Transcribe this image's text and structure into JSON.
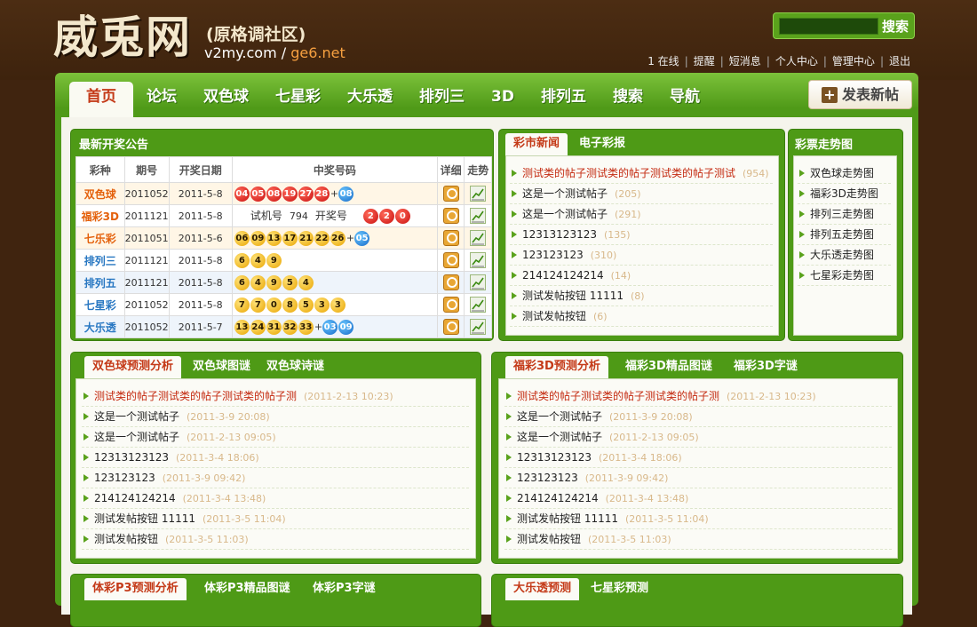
{
  "header": {
    "logo_text": "威兎网",
    "logo_sub": "(原格调社区)",
    "logo_domain1": "v2my.com /",
    "logo_domain2": "ge6.net",
    "search_button": "搜索",
    "search_value": "",
    "user_links": [
      {
        "label": "1 在线",
        "bold": "1"
      },
      {
        "label": "提醒"
      },
      {
        "label": "短消息"
      },
      {
        "label": "个人中心"
      },
      {
        "label": "管理中心"
      },
      {
        "label": "退出"
      }
    ]
  },
  "nav": {
    "tabs": [
      "首页",
      "论坛",
      "双色球",
      "七星彩",
      "大乐透",
      "排列三",
      "3D",
      "排列五",
      "搜索",
      "导航"
    ],
    "active": "首页",
    "post_button": "发表新帖"
  },
  "lottery_box": {
    "title": "最新开奖公告",
    "headers": [
      "彩种",
      "期号",
      "开奖日期",
      "中奖号码",
      "详细",
      "走势"
    ],
    "rows": [
      {
        "kind": "双色球",
        "color": "orange",
        "issue": "2011052",
        "date": "2011-5-8",
        "reds": [
          "04",
          "05",
          "08",
          "19",
          "27",
          "28"
        ],
        "blues": [
          "08"
        ],
        "red_type": "red"
      },
      {
        "kind": "福彩3D",
        "color": "orange",
        "issue": "2011121",
        "date": "2011-5-8",
        "special": true,
        "trial_label": "试机号",
        "trial": "794",
        "draw_label": "开奖号",
        "reds": [
          "2",
          "2",
          "0"
        ],
        "red_type": "red"
      },
      {
        "kind": "七乐彩",
        "color": "orange",
        "issue": "2011051",
        "date": "2011-5-6",
        "reds": [
          "06",
          "09",
          "13",
          "17",
          "21",
          "22",
          "26"
        ],
        "blues": [
          "05"
        ],
        "red_type": "yel"
      },
      {
        "kind": "排列三",
        "color": "blue",
        "issue": "2011121",
        "date": "2011-5-8",
        "reds": [
          "6",
          "4",
          "9"
        ],
        "red_type": "yel"
      },
      {
        "kind": "排列五",
        "color": "blue",
        "issue": "2011121",
        "date": "2011-5-8",
        "reds": [
          "6",
          "4",
          "9",
          "5",
          "4"
        ],
        "red_type": "yel"
      },
      {
        "kind": "七星彩",
        "color": "blue",
        "issue": "2011052",
        "date": "2011-5-8",
        "reds": [
          "7",
          "7",
          "0",
          "8",
          "5",
          "3",
          "3"
        ],
        "red_type": "yel"
      },
      {
        "kind": "大乐透",
        "color": "blue",
        "issue": "2011052",
        "date": "2011-5-7",
        "reds": [
          "13",
          "24",
          "31",
          "32",
          "33"
        ],
        "blues": [
          "03",
          "09"
        ],
        "red_type": "yel"
      }
    ]
  },
  "news_box": {
    "tabs": [
      "彩市新闻",
      "电子彩报"
    ],
    "items": [
      {
        "title": "测试类的帖子测试类的帖子测试类的帖子测试",
        "count": "(954)",
        "hot": true
      },
      {
        "title": "这是一个测试帖子",
        "count": "(205)"
      },
      {
        "title": "这是一个测试帖子",
        "count": "(291)"
      },
      {
        "title": "12313123123",
        "count": "(135)"
      },
      {
        "title": "123123123",
        "count": "(310)"
      },
      {
        "title": "214124124214",
        "count": "(14)"
      },
      {
        "title": "测试发帖按钮 11111",
        "count": "(8)"
      },
      {
        "title": "测试发帖按钮",
        "count": "(6)"
      }
    ]
  },
  "trend_box": {
    "title": "彩票走势图",
    "items": [
      "双色球走势图",
      "福彩3D走势图",
      "排列三走势图",
      "排列五走势图",
      "大乐透走势图",
      "七星彩走势图"
    ]
  },
  "ssq_box": {
    "tabs": [
      "双色球预测分析",
      "双色球图谜",
      "双色球诗谜"
    ],
    "items": [
      {
        "title": "测试类的帖子测试类的帖子测试类的帖子测",
        "date": "(2011-2-13 10:23)",
        "hot": true
      },
      {
        "title": "这是一个测试帖子",
        "date": "(2011-3-9 20:08)"
      },
      {
        "title": "这是一个测试帖子",
        "date": "(2011-2-13 09:05)"
      },
      {
        "title": "12313123123",
        "date": "(2011-3-4 18:06)"
      },
      {
        "title": "123123123",
        "date": "(2011-3-9 09:42)"
      },
      {
        "title": "214124124214",
        "date": "(2011-3-4 13:48)"
      },
      {
        "title": "测试发帖按钮 11111",
        "date": "(2011-3-5 11:04)"
      },
      {
        "title": "测试发帖按钮",
        "date": "(2011-3-5 11:03)"
      }
    ]
  },
  "fc3d_box": {
    "tabs": [
      "福彩3D预测分析",
      "福彩3D精品图谜",
      "福彩3D字谜"
    ],
    "items": [
      {
        "title": "测试类的帖子测试类的帖子测试类的帖子测",
        "date": "(2011-2-13 10:23)",
        "hot": true
      },
      {
        "title": "这是一个测试帖子",
        "date": "(2011-3-9 20:08)"
      },
      {
        "title": "这是一个测试帖子",
        "date": "(2011-2-13 09:05)"
      },
      {
        "title": "12313123123",
        "date": "(2011-3-4 18:06)"
      },
      {
        "title": "123123123",
        "date": "(2011-3-9 09:42)"
      },
      {
        "title": "214124124214",
        "date": "(2011-3-4 13:48)"
      },
      {
        "title": "测试发帖按钮 11111",
        "date": "(2011-3-5 11:04)"
      },
      {
        "title": "测试发帖按钮",
        "date": "(2011-3-5 11:03)"
      }
    ]
  },
  "p3_box": {
    "tabs": [
      "体彩P3预测分析",
      "体彩P3精品图谜",
      "体彩P3字谜"
    ]
  },
  "dlt_box": {
    "tabs": [
      "大乐透预测",
      "七星彩预测"
    ]
  },
  "colors": {
    "green": "#4e9a16",
    "brown": "#40240f",
    "hot_red": "#c42a10",
    "orange": "#e4610c",
    "blue": "#2877c2"
  }
}
